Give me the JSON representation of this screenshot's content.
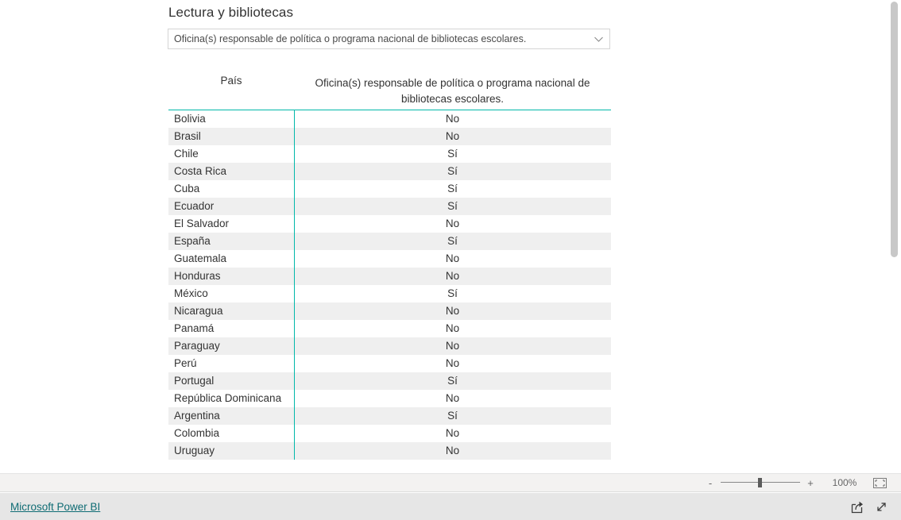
{
  "visual": {
    "title": "Lectura y bibliotecas"
  },
  "slicer": {
    "selected_value": "Oficina(s) responsable de política o programa nacional de bibliotecas escolares.",
    "chevron_icon": "chevron-down-icon"
  },
  "table": {
    "columns": [
      "País",
      "Oficina(s) responsable de política o programa nacional de bibliotecas escolares."
    ],
    "accent_color": "#01b8aa",
    "alt_row_color": "#efefef",
    "rows": [
      {
        "country": "Bolivia",
        "value": "No"
      },
      {
        "country": "Brasil",
        "value": "No"
      },
      {
        "country": "Chile",
        "value": "Sí"
      },
      {
        "country": "Costa Rica",
        "value": "Sí"
      },
      {
        "country": "Cuba",
        "value": "Sí"
      },
      {
        "country": "Ecuador",
        "value": "Sí"
      },
      {
        "country": "El Salvador",
        "value": "No"
      },
      {
        "country": "España",
        "value": "Sí"
      },
      {
        "country": "Guatemala",
        "value": "No"
      },
      {
        "country": "Honduras",
        "value": "No"
      },
      {
        "country": "México",
        "value": "Sí"
      },
      {
        "country": "Nicaragua",
        "value": "No"
      },
      {
        "country": "Panamá",
        "value": "No"
      },
      {
        "country": "Paraguay",
        "value": "No"
      },
      {
        "country": "Perú",
        "value": "No"
      },
      {
        "country": "Portugal",
        "value": "Sí"
      },
      {
        "country": "República Dominicana",
        "value": "No"
      },
      {
        "country": "Argentina",
        "value": "Sí"
      },
      {
        "country": "Colombia",
        "value": "No"
      },
      {
        "country": "Uruguay",
        "value": "No"
      }
    ]
  },
  "zoom_bar": {
    "zoom_out_label": "-",
    "zoom_in_label": "+",
    "zoom_level": "100%",
    "fit_icon": "fit-to-page-icon"
  },
  "footer": {
    "brand_link": "Microsoft Power BI",
    "share_icon": "share-export-icon",
    "fullscreen_icon": "fullscreen-expand-icon"
  }
}
